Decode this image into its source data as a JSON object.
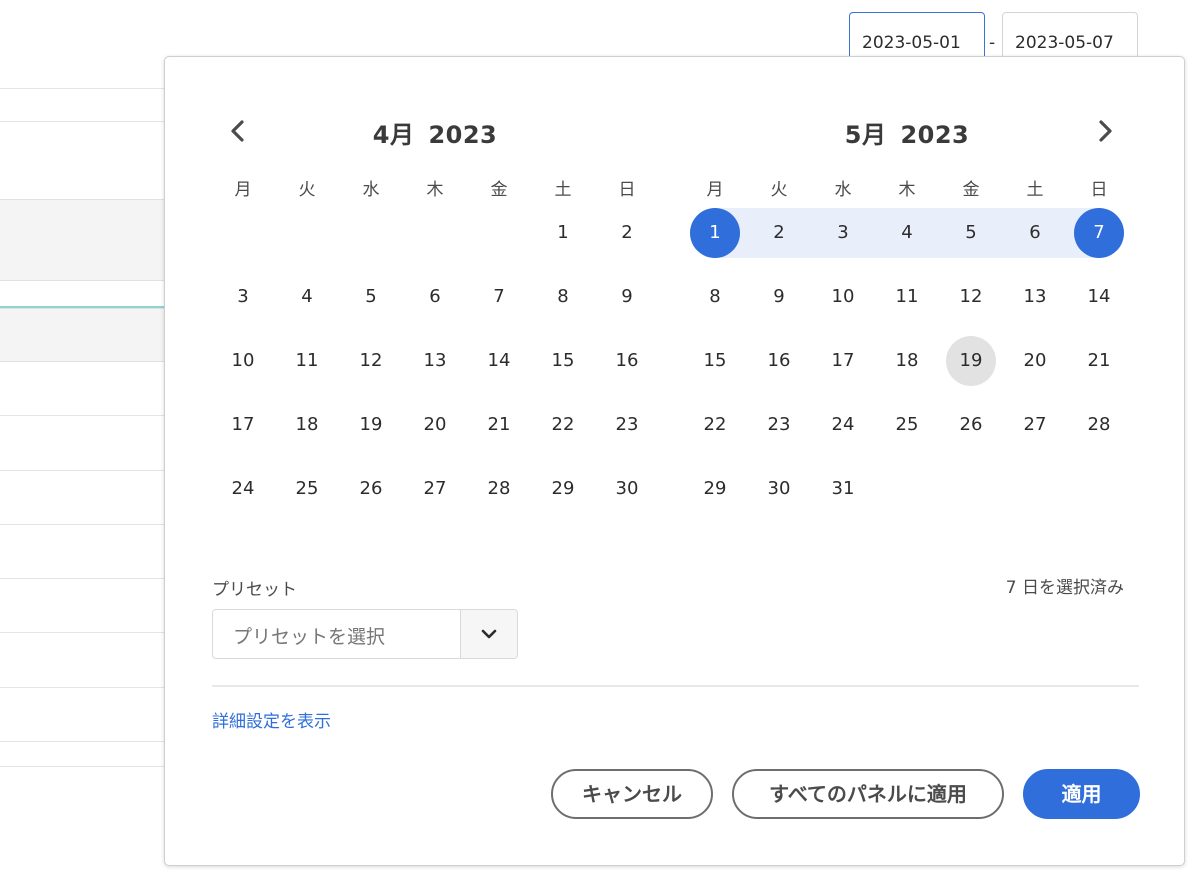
{
  "date_range": {
    "start": "2023-05-01",
    "separator": "-",
    "end": "2023-05-07"
  },
  "calendar": {
    "prev_icon": "chevron-left-icon",
    "next_icon": "chevron-right-icon",
    "weekdays": [
      "月",
      "火",
      "水",
      "木",
      "金",
      "土",
      "日"
    ],
    "months": [
      {
        "month_label": "4月",
        "year_label": "2023",
        "weeks": [
          [
            "",
            "",
            "",
            "",
            "",
            "1",
            "2"
          ],
          [
            "3",
            "4",
            "5",
            "6",
            "7",
            "8",
            "9"
          ],
          [
            "10",
            "11",
            "12",
            "13",
            "14",
            "15",
            "16"
          ],
          [
            "17",
            "18",
            "19",
            "20",
            "21",
            "22",
            "23"
          ],
          [
            "24",
            "25",
            "26",
            "27",
            "28",
            "29",
            "30"
          ]
        ]
      },
      {
        "month_label": "5月",
        "year_label": "2023",
        "weeks": [
          [
            "1",
            "2",
            "3",
            "4",
            "5",
            "6",
            "7"
          ],
          [
            "8",
            "9",
            "10",
            "11",
            "12",
            "13",
            "14"
          ],
          [
            "15",
            "16",
            "17",
            "18",
            "19",
            "20",
            "21"
          ],
          [
            "22",
            "23",
            "24",
            "25",
            "26",
            "27",
            "28"
          ],
          [
            "29",
            "30",
            "31",
            "",
            "",
            "",
            ""
          ]
        ],
        "selected_endpoints": [
          "1",
          "7"
        ],
        "today": "19"
      }
    ],
    "colors": {
      "accent": "#2f6edb",
      "range_fill": "#e8effb",
      "today_fill": "#e2e2e2"
    }
  },
  "preset": {
    "label": "プリセット",
    "placeholder": "プリセットを選択",
    "dropdown_icon": "chevron-down-icon"
  },
  "selected_count": "7 日を選択済み",
  "advanced_link": "詳細設定を表示",
  "buttons": {
    "cancel": "キャンセル",
    "apply_all": "すべてのパネルに適用",
    "apply": "適用"
  }
}
